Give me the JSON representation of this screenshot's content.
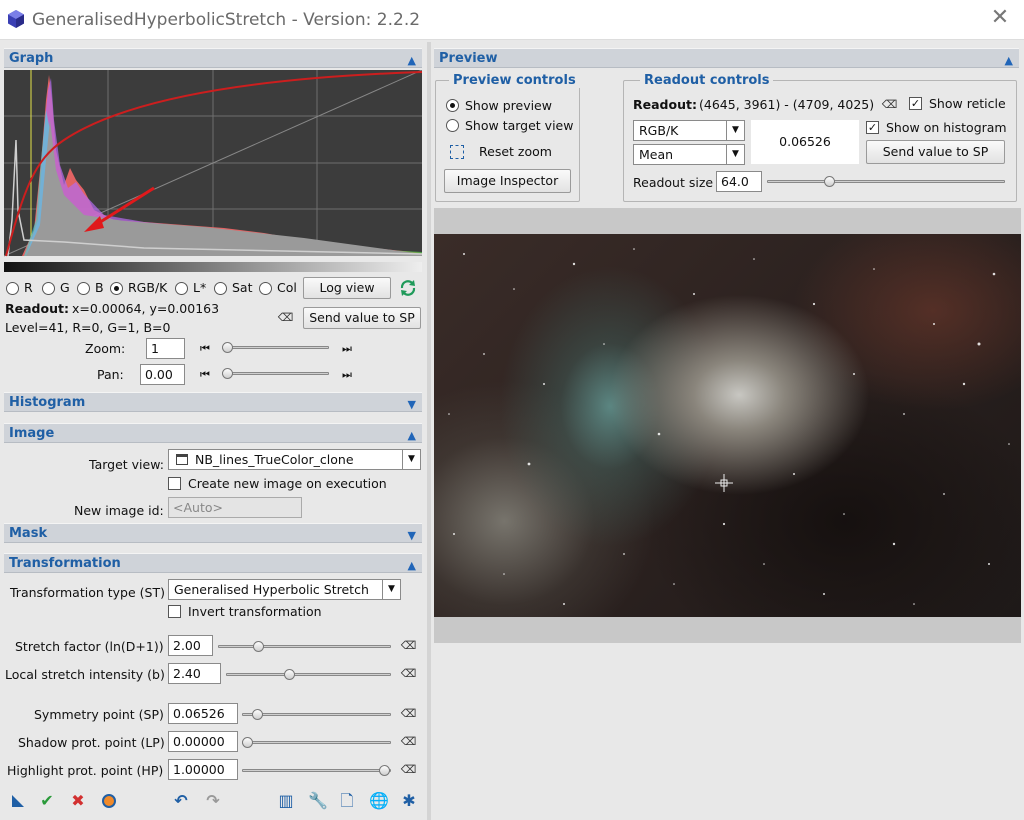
{
  "window": {
    "title": "GeneralisedHyperbolicStretch - Version: 2.2.2",
    "close_glyph": "✕"
  },
  "graph": {
    "section_title": "Graph",
    "channels": [
      "R",
      "G",
      "B",
      "RGB/K",
      "L*",
      "Sat",
      "Col"
    ],
    "selected_channel": "RGB/K",
    "log_view_label": "Log view",
    "readout_label": "Readout:",
    "readout_value": "x=0.00064, y=0.00163",
    "level_text": "Level=41, R=0, G=1, B=0",
    "send_label": "Send value to SP",
    "zoom_label": "Zoom:",
    "zoom_value": "1",
    "pan_label": "Pan:",
    "pan_value": "0.00"
  },
  "histogram": {
    "section_title": "Histogram"
  },
  "image": {
    "section_title": "Image",
    "target_view_label": "Target view:",
    "target_view_value": "NB_lines_TrueColor_clone",
    "create_new_label": "Create new image on execution",
    "new_id_label": "New image id:",
    "new_id_placeholder": "<Auto>"
  },
  "mask": {
    "section_title": "Mask"
  },
  "transformation": {
    "section_title": "Transformation",
    "type_label": "Transformation type (ST)",
    "type_value": "Generalised Hyperbolic Stretch",
    "invert_label": "Invert transformation",
    "params": [
      {
        "label": "Stretch factor (ln(D+1))",
        "value": "2.00",
        "fraction": 0.22
      },
      {
        "label": "Local stretch intensity (b)",
        "value": "2.40",
        "fraction": 0.38
      },
      {
        "label": "Symmetry point (SP)",
        "value": "0.06526",
        "fraction": 0.07
      },
      {
        "label": "Shadow prot. point (LP)",
        "value": "0.00000",
        "fraction": 0.0
      },
      {
        "label": "Highlight prot. point (HP)",
        "value": "1.00000",
        "fraction": 1.0
      }
    ]
  },
  "preview": {
    "section_title": "Preview",
    "controls_title": "Preview controls",
    "show_preview_label": "Show preview",
    "show_target_label": "Show target view",
    "reset_zoom_label": "Reset zoom",
    "inspector_label": "Image Inspector",
    "readout_title": "Readout controls",
    "readout_label": "Readout:",
    "readout_coords": "(4645, 3961) - (4709, 4025)",
    "show_reticle_label": "Show reticle",
    "show_on_hist_label": "Show on histogram",
    "channel_value": "RGB/K",
    "stat_value": "Mean",
    "readout_number": "0.06526",
    "send_label": "Send value to SP",
    "size_label": "Readout size",
    "size_value": "64.0"
  },
  "colors": {
    "accent": "#1f5fa5",
    "header_bg": "#cfd3d9",
    "graph_bg": "#3c3c3c",
    "curve": "#cc1e1e"
  }
}
